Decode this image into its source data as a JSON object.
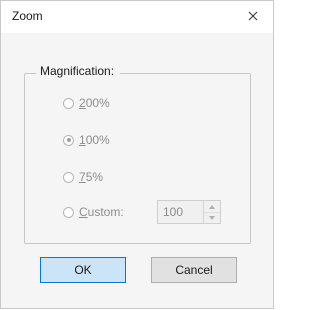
{
  "dialog": {
    "title": "Zoom",
    "close_glyph": "×",
    "group": {
      "label": "Magnification:",
      "options": [
        {
          "pre": "",
          "mnemonic": "2",
          "post": "00%",
          "checked": false
        },
        {
          "pre": "",
          "mnemonic": "1",
          "post": "00%",
          "checked": true
        },
        {
          "pre": "",
          "mnemonic": "7",
          "post": "5%",
          "checked": false
        },
        {
          "pre": "",
          "mnemonic": "C",
          "post": "ustom:",
          "checked": false
        }
      ],
      "custom_value": "100"
    },
    "buttons": {
      "ok": "OK",
      "cancel": "Cancel"
    }
  },
  "colors": {
    "accent": "#0078d7",
    "ok_fill": "#cce4f7",
    "disabled_text": "#8c8c8c"
  },
  "icons": [
    "close-icon",
    "spin-up-icon",
    "spin-down-icon"
  ]
}
